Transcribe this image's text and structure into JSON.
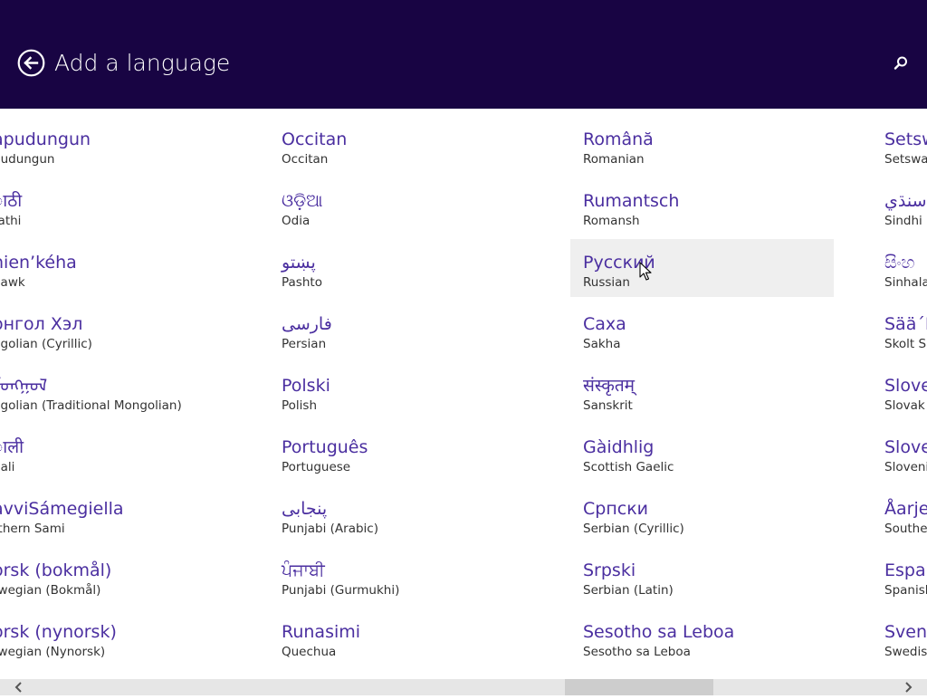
{
  "header": {
    "title": "Add a language",
    "back_icon": "back-arrow-circle-icon",
    "search_icon": "search-icon",
    "background": "#180443"
  },
  "colors": {
    "native_text": "#4b2fa0",
    "english_text": "#333333",
    "hover_background": "#efefef"
  },
  "columns": [
    {
      "items": [
        {
          "native": "apudungun",
          "english": "pudungun"
        },
        {
          "native": "ाठी",
          "english": "rathi"
        },
        {
          "native": "nien’kéha",
          "english": "hawk"
        },
        {
          "native": "онгол Хэл",
          "english": "ngolian (Cyrillic)"
        },
        {
          "native": "ᠮᠣᠩᠭᠣᠯ",
          "english": "ngolian (Traditional Mongolian)"
        },
        {
          "native": "ाली",
          "english": "pali"
        },
        {
          "native": "avviSámegiella",
          "english": "rthern Sami"
        },
        {
          "native": "orsk (bokmål)",
          "english": "rwegian (Bokmål)"
        },
        {
          "native": "orsk (nynorsk)",
          "english": "rwegian (Nynorsk)"
        }
      ]
    },
    {
      "items": [
        {
          "native": "Occitan",
          "english": "Occitan"
        },
        {
          "native": "ଓଡ଼ିଆ",
          "english": "Odia"
        },
        {
          "native": "پښتو",
          "english": "Pashto"
        },
        {
          "native": "فارسى",
          "english": "Persian"
        },
        {
          "native": "Polski",
          "english": "Polish"
        },
        {
          "native": "Português",
          "english": "Portuguese"
        },
        {
          "native": "پنجابی",
          "english": "Punjabi (Arabic)"
        },
        {
          "native": "ਪੰਜਾਬੀ",
          "english": "Punjabi (Gurmukhi)"
        },
        {
          "native": "Runasimi",
          "english": "Quechua"
        }
      ]
    },
    {
      "items": [
        {
          "native": "Română",
          "english": "Romanian"
        },
        {
          "native": "Rumantsch",
          "english": "Romansh"
        },
        {
          "native": "Русский",
          "english": "Russian"
        },
        {
          "native": "Саха",
          "english": "Sakha"
        },
        {
          "native": "संस्कृतम्",
          "english": "Sanskrit"
        },
        {
          "native": "Gàidhlig",
          "english": "Scottish Gaelic"
        },
        {
          "native": "Српски",
          "english": "Serbian (Cyrillic)"
        },
        {
          "native": "Srpski",
          "english": "Serbian (Latin)"
        },
        {
          "native": "Sesotho sa Leboa",
          "english": "Sesotho sa Leboa"
        }
      ]
    },
    {
      "items": [
        {
          "native": "Setsw",
          "english": "Setswan"
        },
        {
          "native": "سنڌي",
          "english": "Sindhi ("
        },
        {
          "native": "සිංහ",
          "english": "Sinhala"
        },
        {
          "native": "Sää´M",
          "english": "Skolt Sa"
        },
        {
          "native": "Slove",
          "english": "Slovak"
        },
        {
          "native": "Slove",
          "english": "Slovenia"
        },
        {
          "native": "Åarje",
          "english": "Southe"
        },
        {
          "native": "Españ",
          "english": "Spanish"
        },
        {
          "native": "Svens",
          "english": "Swedish"
        }
      ]
    }
  ],
  "hovered_item": "Русский",
  "scrollbar": {
    "left_icon": "chevron-left-icon",
    "right_icon": "chevron-right-icon"
  }
}
